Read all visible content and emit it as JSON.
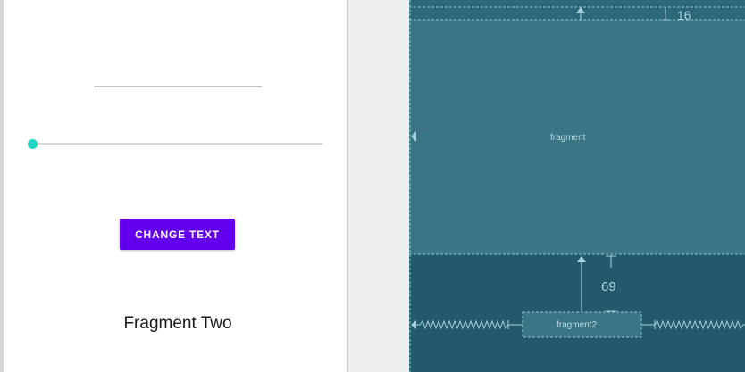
{
  "preview": {
    "button_label": "CHANGE TEXT",
    "fragment_label": "Fragment Two",
    "seekbar_progress": 0
  },
  "blueprint": {
    "top_fragment_label": "fragment",
    "bottom_fragment_label": "fragment2",
    "top_margin_value": "16",
    "fragment2_margin_value": "69"
  },
  "colors": {
    "accent_button": "#6200ee",
    "seekbar_thumb": "#1ed6c4",
    "blueprint_bg": "#235a6b",
    "blueprint_selected": "#3a7585"
  }
}
